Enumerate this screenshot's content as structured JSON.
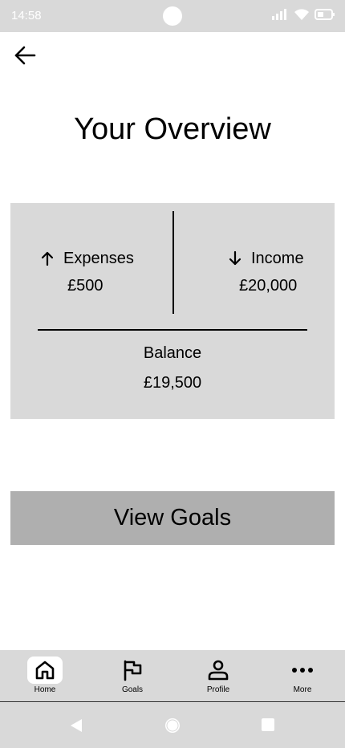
{
  "status_bar": {
    "time": "14:58"
  },
  "page": {
    "title": "Your Overview"
  },
  "summary": {
    "expenses_label": "Expenses",
    "expenses_value": "£500",
    "income_label": "Income",
    "income_value": "£20,000",
    "balance_label": "Balance",
    "balance_value": "£19,500"
  },
  "actions": {
    "view_goals_label": "View Goals"
  },
  "bottom_nav": {
    "items": [
      {
        "label": "Home",
        "icon": "home-icon",
        "active": true
      },
      {
        "label": "Goals",
        "icon": "flag-icon",
        "active": false
      },
      {
        "label": "Profile",
        "icon": "person-icon",
        "active": false
      },
      {
        "label": "More",
        "icon": "more-icon",
        "active": false
      }
    ]
  },
  "colors": {
    "surface": "#d9d9d9",
    "button": "#afafaf",
    "text": "#000000"
  }
}
